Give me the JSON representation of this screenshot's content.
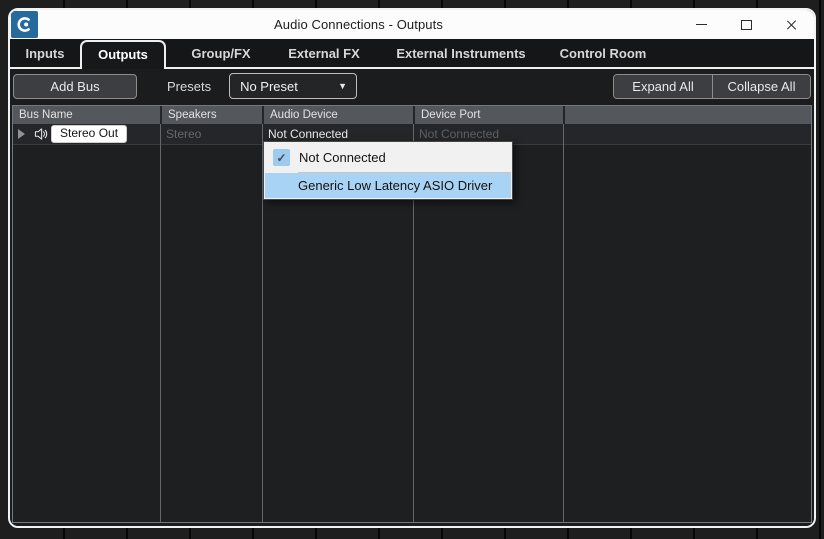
{
  "window": {
    "title": "Audio Connections - Outputs"
  },
  "tabs": [
    {
      "label": "Inputs",
      "active": false
    },
    {
      "label": "Outputs",
      "active": true
    },
    {
      "label": "Group/FX",
      "active": false
    },
    {
      "label": "External FX",
      "active": false
    },
    {
      "label": "External Instruments",
      "active": false
    },
    {
      "label": "Control Room",
      "active": false
    }
  ],
  "toolbar": {
    "add_bus_label": "Add Bus",
    "presets_label": "Presets",
    "preset_value": "No Preset",
    "expand_all_label": "Expand All",
    "collapse_all_label": "Collapse All"
  },
  "table": {
    "columns": [
      "Bus Name",
      "Speakers",
      "Audio Device",
      "Device Port"
    ],
    "rows": [
      {
        "bus_name": "Stereo Out",
        "speakers": "Stereo",
        "audio_device": "Not Connected",
        "device_port": "Not Connected"
      }
    ]
  },
  "audio_device_menu": {
    "items": [
      {
        "label": "Not Connected",
        "checked": true,
        "highlighted": false
      },
      {
        "label": "Generic Low Latency ASIO Driver",
        "checked": false,
        "highlighted": true
      }
    ]
  },
  "icons": {
    "check": "✓",
    "dropdown_arrow": "▼"
  },
  "colors": {
    "selection_blue": "#a9d3f4",
    "check_blue": "#9dcbef",
    "logo_blue": "#26699c",
    "header_gray": "#54575b",
    "window_border": "#f2f2f2"
  }
}
